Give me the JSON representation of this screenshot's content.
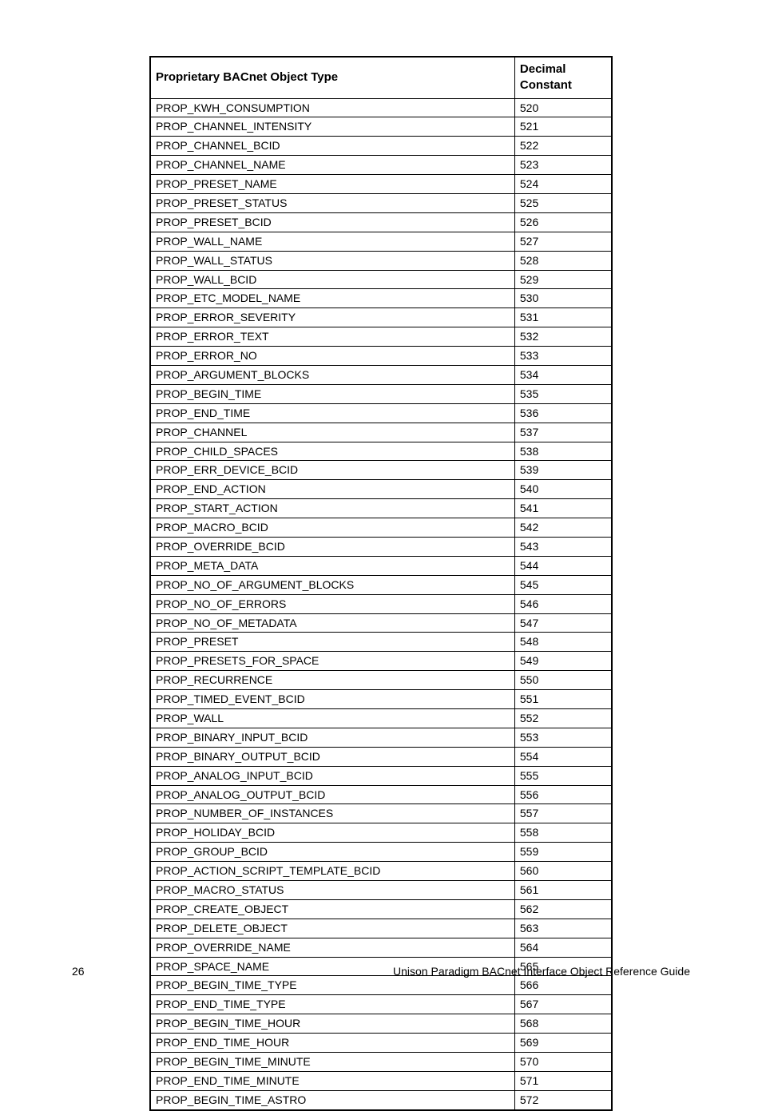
{
  "table": {
    "headers": {
      "name": "Proprietary BACnet Object Type",
      "constant": "Decimal Constant"
    },
    "rows": [
      {
        "name": "PROP_KWH_CONSUMPTION",
        "constant": "520"
      },
      {
        "name": "PROP_CHANNEL_INTENSITY",
        "constant": "521"
      },
      {
        "name": "PROP_CHANNEL_BCID",
        "constant": "522"
      },
      {
        "name": "PROP_CHANNEL_NAME",
        "constant": "523"
      },
      {
        "name": "PROP_PRESET_NAME",
        "constant": "524"
      },
      {
        "name": "PROP_PRESET_STATUS",
        "constant": "525"
      },
      {
        "name": "PROP_PRESET_BCID",
        "constant": "526"
      },
      {
        "name": "PROP_WALL_NAME",
        "constant": "527"
      },
      {
        "name": "PROP_WALL_STATUS",
        "constant": "528"
      },
      {
        "name": "PROP_WALL_BCID",
        "constant": "529"
      },
      {
        "name": "PROP_ETC_MODEL_NAME",
        "constant": "530"
      },
      {
        "name": "PROP_ERROR_SEVERITY",
        "constant": "531"
      },
      {
        "name": "PROP_ERROR_TEXT",
        "constant": "532"
      },
      {
        "name": "PROP_ERROR_NO",
        "constant": "533"
      },
      {
        "name": "PROP_ARGUMENT_BLOCKS",
        "constant": "534"
      },
      {
        "name": "PROP_BEGIN_TIME",
        "constant": "535"
      },
      {
        "name": "PROP_END_TIME",
        "constant": "536"
      },
      {
        "name": "PROP_CHANNEL",
        "constant": "537"
      },
      {
        "name": "PROP_CHILD_SPACES",
        "constant": "538"
      },
      {
        "name": "PROP_ERR_DEVICE_BCID",
        "constant": "539"
      },
      {
        "name": "PROP_END_ACTION",
        "constant": "540"
      },
      {
        "name": "PROP_START_ACTION",
        "constant": "541"
      },
      {
        "name": "PROP_MACRO_BCID",
        "constant": "542"
      },
      {
        "name": "PROP_OVERRIDE_BCID",
        "constant": "543"
      },
      {
        "name": "PROP_META_DATA",
        "constant": "544"
      },
      {
        "name": "PROP_NO_OF_ARGUMENT_BLOCKS",
        "constant": "545"
      },
      {
        "name": "PROP_NO_OF_ERRORS",
        "constant": "546"
      },
      {
        "name": "PROP_NO_OF_METADATA",
        "constant": "547"
      },
      {
        "name": "PROP_PRESET",
        "constant": "548"
      },
      {
        "name": "PROP_PRESETS_FOR_SPACE",
        "constant": "549"
      },
      {
        "name": "PROP_RECURRENCE",
        "constant": "550"
      },
      {
        "name": "PROP_TIMED_EVENT_BCID",
        "constant": "551"
      },
      {
        "name": "PROP_WALL",
        "constant": "552"
      },
      {
        "name": "PROP_BINARY_INPUT_BCID",
        "constant": "553"
      },
      {
        "name": "PROP_BINARY_OUTPUT_BCID",
        "constant": "554"
      },
      {
        "name": "PROP_ANALOG_INPUT_BCID",
        "constant": "555"
      },
      {
        "name": "PROP_ANALOG_OUTPUT_BCID",
        "constant": "556"
      },
      {
        "name": "PROP_NUMBER_OF_INSTANCES",
        "constant": "557"
      },
      {
        "name": "PROP_HOLIDAY_BCID",
        "constant": "558"
      },
      {
        "name": "PROP_GROUP_BCID",
        "constant": "559"
      },
      {
        "name": "PROP_ACTION_SCRIPT_TEMPLATE_BCID",
        "constant": "560"
      },
      {
        "name": "PROP_MACRO_STATUS",
        "constant": "561"
      },
      {
        "name": "PROP_CREATE_OBJECT",
        "constant": "562"
      },
      {
        "name": "PROP_DELETE_OBJECT",
        "constant": "563"
      },
      {
        "name": "PROP_OVERRIDE_NAME",
        "constant": "564"
      },
      {
        "name": "PROP_SPACE_NAME",
        "constant": "565"
      },
      {
        "name": "PROP_BEGIN_TIME_TYPE",
        "constant": "566"
      },
      {
        "name": "PROP_END_TIME_TYPE",
        "constant": "567"
      },
      {
        "name": "PROP_BEGIN_TIME_HOUR",
        "constant": "568"
      },
      {
        "name": "PROP_END_TIME_HOUR",
        "constant": "569"
      },
      {
        "name": "PROP_BEGIN_TIME_MINUTE",
        "constant": "570"
      },
      {
        "name": "PROP_END_TIME_MINUTE",
        "constant": "571"
      },
      {
        "name": "PROP_BEGIN_TIME_ASTRO",
        "constant": "572"
      }
    ]
  },
  "footer": {
    "page_number": "26",
    "doc_title": "Unison Paradigm BACnet Interface Object Reference Guide"
  }
}
